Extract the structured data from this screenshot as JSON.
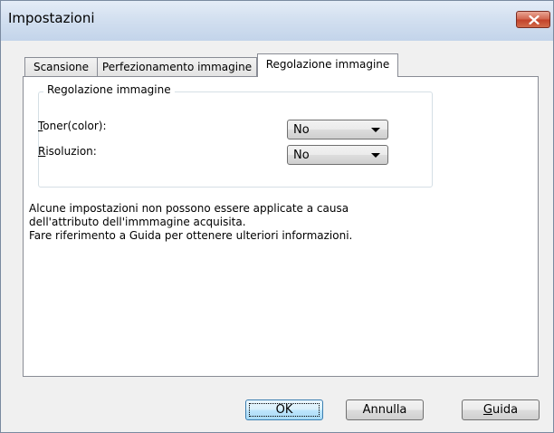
{
  "window": {
    "title": "Impostazioni",
    "close_icon": "close-icon"
  },
  "tabs": [
    {
      "label": "Scansione",
      "active": false
    },
    {
      "label": "Perfezionamento immagine",
      "active": false
    },
    {
      "label": "Regolazione immagine",
      "active": true
    }
  ],
  "group": {
    "caption": "Regolazione immagine",
    "fields": [
      {
        "label_mnemonic": "T",
        "label_rest": "oner(color):",
        "value": "No"
      },
      {
        "label_mnemonic": "R",
        "label_rest": "isoluzion:",
        "value": "No"
      }
    ]
  },
  "info": {
    "line1": "Alcune impostazioni non possono essere applicate a causa",
    "line2": "dell'attributo dell'immmagine acquisita.",
    "line3": "Fare riferimento a Guida per ottenere ulteriori informazioni."
  },
  "buttons": {
    "ok": "OK",
    "cancel": "Annulla",
    "help_mnemonic": "G",
    "help_rest": "uida"
  },
  "colors": {
    "close_button": "#c2412a",
    "default_button_border": "#3c7fb1"
  }
}
